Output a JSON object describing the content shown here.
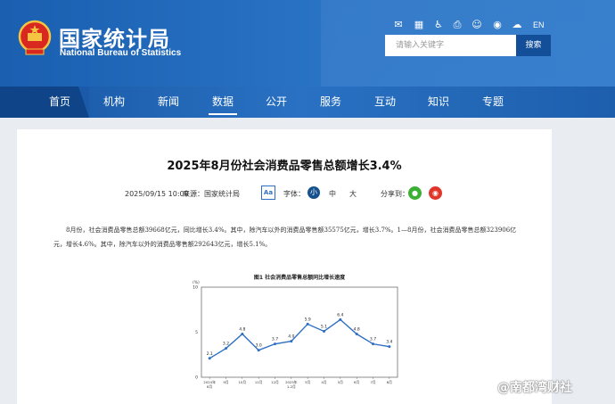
{
  "header": {
    "brand_cn": "国家统计局",
    "brand_en": "National Bureau of Statistics",
    "lang": "EN",
    "search_placeholder": "请输入关键字",
    "search_button": "搜索",
    "colors": {
      "primary": "#1a5fb0",
      "nav": "#1a5aa8",
      "button": "#134f99"
    }
  },
  "nav": {
    "items": [
      "首页",
      "机构",
      "新闻",
      "数据",
      "公开",
      "服务",
      "互动",
      "知识",
      "专题"
    ],
    "active": "数据"
  },
  "article": {
    "title": "2025年8月份社会消费品零售总额增长3.4%",
    "date": "2025/09/15 10:00",
    "source": "来源：国家统计局",
    "font_label": "字体：",
    "size_icon": "Aa",
    "size_small": "小",
    "size_medium": "中",
    "size_large": "大",
    "share_label": "分享到：",
    "paragraph": "8月份，社会消费品零售总额39668亿元，同比增长3.4%。其中，除汽车以外的消费品零售额35575亿元，增长3.7%。1—8月份，社会消费品零售总额323906亿元，增长4.6%。其中，除汽车以外的消费品零售额292643亿元，增长5.1%。"
  },
  "watermark": "@南都湾财社",
  "chart_data": {
    "type": "line",
    "title": "图1  社会消费品零售总额同比增长速度",
    "ylabel": "(%)",
    "ylim": [
      0,
      10
    ],
    "yticks": [
      0,
      5,
      10
    ],
    "categories": [
      "2024年8月",
      "9月",
      "10月",
      "11月",
      "12月",
      "2025年1-2月",
      "3月",
      "4月",
      "5月",
      "6月",
      "7月",
      "8月"
    ],
    "values": [
      2.1,
      3.2,
      4.8,
      3.0,
      3.7,
      4.0,
      5.9,
      5.1,
      6.4,
      4.8,
      3.7,
      3.4
    ],
    "color": "#2e6fc4"
  }
}
